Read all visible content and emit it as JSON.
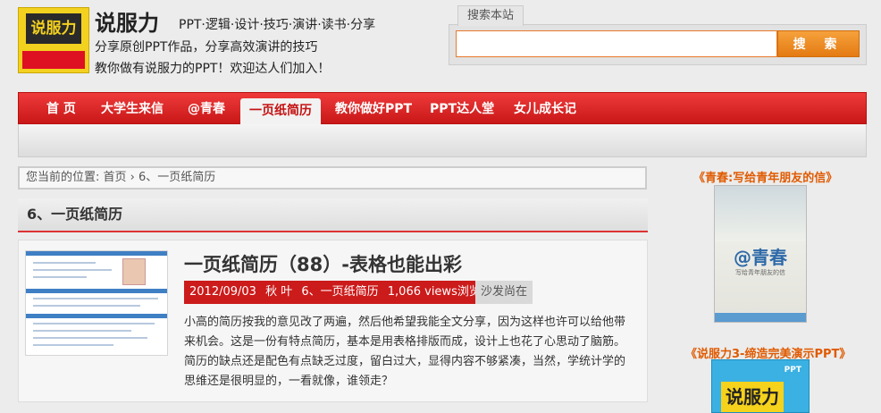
{
  "header": {
    "logo_text": "说服力",
    "title": "说服力",
    "tags": "PPT·逻辑·设计·技巧·演讲·读书·分享",
    "desc1": "分享原创PPT作品，分享高效演讲的技巧",
    "desc2": "教你做有说服力的PPT！欢迎达人们加入！"
  },
  "search": {
    "tab_label": "搜索本站",
    "placeholder": "",
    "button_label": "搜 索"
  },
  "nav": {
    "items": [
      {
        "label": "首 页"
      },
      {
        "label": "大学生来信"
      },
      {
        "label": "@青春"
      },
      {
        "label": "一页纸简历"
      },
      {
        "label": "教你做好PPT"
      },
      {
        "label": "PPT达人堂"
      },
      {
        "label": "女儿成长记"
      }
    ],
    "active_index": 3
  },
  "breadcrumb": "您当前的位置: 首页 › 6、一页纸简历",
  "category_title": "6、一页纸简历",
  "post": {
    "title": "一页纸简历（88）-表格也能出彩",
    "date": "2012/09/03",
    "author": "秋 叶",
    "category": "6、一页纸简历",
    "views": "1,066 views浏览",
    "comment": "沙发尚在",
    "excerpt": "小高的简历按我的意见改了两遍，然后他希望我能全文分享，因为这样也许可以给他带来机会。这是一份有特点简历，基本是用表格排版而成，设计上也花了心思动了脑筋。简历的缺点还是配色有点缺乏过度，留白过大，显得内容不够紧凑，当然，学统计学的思维还是很明显的，一看就像，谁领走？"
  },
  "sidebar": {
    "book1_link": "《青春:写给青年朋友的信》",
    "book1_cover_mark": "@青春",
    "book1_cover_sub": "写给青年朋友的信",
    "book2_link": "《说服力3-缔造完美演示PPT》",
    "book2_cover_text": "说服力",
    "book2_cover_ppt": "PPT"
  },
  "colors": {
    "nav_red": "#cc1b1b",
    "accent_orange": "#e05a00",
    "search_orange": "#e87a2b"
  }
}
